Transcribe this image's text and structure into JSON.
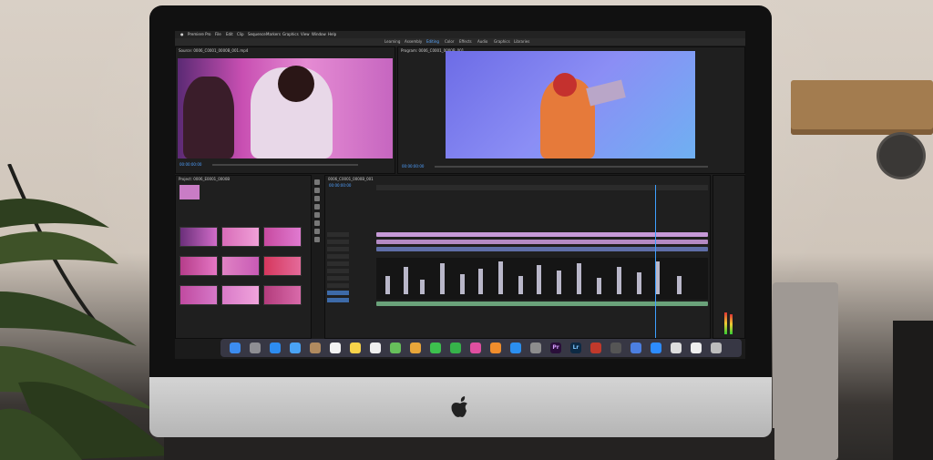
{
  "menubar": {
    "app_name": "Premiere Pro",
    "items": [
      "File",
      "Edit",
      "Clip",
      "Sequence",
      "Markers",
      "Graphics",
      "View",
      "Window",
      "Help"
    ]
  },
  "workspace_tabs": [
    "Learning",
    "Assembly",
    "Editing",
    "Color",
    "Effects",
    "Audio",
    "Graphics",
    "Libraries"
  ],
  "source_panel": {
    "title": "Source: 0006_C0001_0000B_001.mp4",
    "timecode": "00:00:00:00"
  },
  "program_panel": {
    "title": "Program: 0006_C0001_0000B_001",
    "timecode": "00:00:00:00"
  },
  "project_panel": {
    "title": "Project: 0006_E0001_0000B"
  },
  "timeline_panel": {
    "title": "0006_C0001_0000B_001",
    "timecode": "00:00:00:00"
  },
  "dock": {
    "apps": [
      {
        "name": "finder",
        "label": "",
        "color": "#3c8cf0"
      },
      {
        "name": "launchpad",
        "label": "",
        "color": "#8e8e93"
      },
      {
        "name": "safari",
        "label": "",
        "color": "#2d8cf0"
      },
      {
        "name": "mail",
        "label": "",
        "color": "#4aa3f5"
      },
      {
        "name": "contacts",
        "label": "",
        "color": "#b08a5f"
      },
      {
        "name": "calendar",
        "label": "",
        "color": "#f2f2f2"
      },
      {
        "name": "notes",
        "label": "",
        "color": "#f7d34a"
      },
      {
        "name": "reminders",
        "label": "",
        "color": "#efefef"
      },
      {
        "name": "maps",
        "label": "",
        "color": "#67c05b"
      },
      {
        "name": "photos",
        "label": "",
        "color": "#e8a63a"
      },
      {
        "name": "messages",
        "label": "",
        "color": "#3dc14e"
      },
      {
        "name": "facetime",
        "label": "",
        "color": "#36b24a"
      },
      {
        "name": "itunes",
        "label": "",
        "color": "#e04fa0"
      },
      {
        "name": "books",
        "label": "",
        "color": "#f08d2c"
      },
      {
        "name": "app-store",
        "label": "",
        "color": "#2b8ff0"
      },
      {
        "name": "system-preferences",
        "label": "",
        "color": "#8d8d8d"
      },
      {
        "name": "premiere-pro",
        "label": "Pr",
        "color": "#2a0f3a"
      },
      {
        "name": "lightroom",
        "label": "Lr",
        "color": "#0d2a44"
      },
      {
        "name": "photo-booth",
        "label": "",
        "color": "#c0392b"
      },
      {
        "name": "utility",
        "label": "",
        "color": "#555"
      },
      {
        "name": "downloads",
        "label": "",
        "color": "#4c7fe0"
      },
      {
        "name": "zoom",
        "label": "",
        "color": "#2d8cff"
      },
      {
        "name": "screenshot",
        "label": "",
        "color": "#ddd"
      },
      {
        "name": "documents",
        "label": "",
        "color": "#eee"
      },
      {
        "name": "trash",
        "label": "",
        "color": "#bdbdbd"
      }
    ]
  },
  "colors": {
    "accent": "#3ea0ff",
    "bezel": "#111111",
    "chin": "#c8c8c8"
  }
}
